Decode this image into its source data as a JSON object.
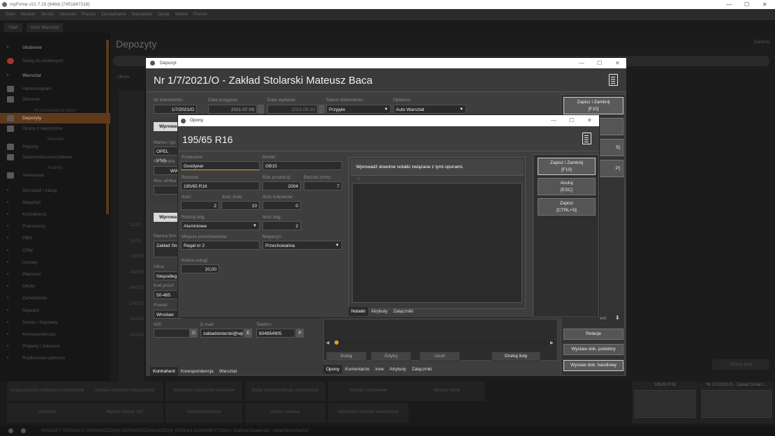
{
  "app": {
    "title": "mpFirma v21.7.15 (64bit) [7451847216]",
    "menu": [
      "Start",
      "Moduły",
      "Skróty",
      "Słowniki",
      "Poczta",
      "Zarządzanie",
      "Narzędzia",
      "Opcje",
      "Widok",
      "Pomoc"
    ],
    "tabs": [
      "Start",
      "Auto Warsztat"
    ]
  },
  "sidebar": {
    "items": [
      {
        "label": "Ulubione",
        "type": "head"
      },
      {
        "label": "Dodaj do ulubionych",
        "type": "item"
      },
      {
        "label": "Warsztat",
        "type": "head"
      },
      {
        "label": "Harmonogram",
        "type": "item"
      },
      {
        "label": "Zlecenia",
        "type": "item"
      },
      {
        "label": "Przechowalnia opon",
        "type": "sub"
      },
      {
        "label": "Depozyty",
        "type": "active"
      },
      {
        "label": "Opony z depozytów",
        "type": "item"
      },
      {
        "label": "Słowniki",
        "type": "sub"
      },
      {
        "label": "Pojazdy",
        "type": "item"
      },
      {
        "label": "Stanowiska warsztatowe",
        "type": "item"
      },
      {
        "label": "Analizy",
        "type": "sub"
      },
      {
        "label": "Serwisanci",
        "type": "item"
      },
      {
        "label": "Sprzedaż i zakup",
        "type": "cat"
      },
      {
        "label": "Magazyn",
        "type": "cat"
      },
      {
        "label": "Kontrahenci",
        "type": "cat"
      },
      {
        "label": "Pracownicy",
        "type": "cat"
      },
      {
        "label": "PBKi",
        "type": "cat"
      },
      {
        "label": "CRM",
        "type": "cat"
      },
      {
        "label": "Umowy",
        "type": "cat"
      },
      {
        "label": "Płatności",
        "type": "cat"
      },
      {
        "label": "Oferty",
        "type": "cat"
      },
      {
        "label": "Zamówienia",
        "type": "cat"
      },
      {
        "label": "Rejestry",
        "type": "cat"
      },
      {
        "label": "Serwis i Naprawy",
        "type": "cat"
      },
      {
        "label": "Korespondencja",
        "type": "cat"
      },
      {
        "label": "Projekty i Zlecenia",
        "type": "cat"
      },
      {
        "label": "Rozliczenia cykliczne",
        "type": "cat"
      }
    ]
  },
  "main": {
    "title": "Depozyty",
    "close_label": "Zamknij",
    "print_list": "Drukuj listę",
    "okres_label": "Okres"
  },
  "bottom_tiles": [
    "Dodaj przycisk szybkiego uruchamiania",
    "Wystaw dokument magazynowy",
    "Wprowadź zgłoszenie serwisowe",
    "Dodaj korespondencję (zewnętrzną)",
    "Wystaw zamówienie",
    "Wystaw ofertę",
    "Sprzedaż",
    "Wystaw fakturę VAT",
    "Dodaj kontrahenta",
    "Utwórz zadanie",
    "Wprowadź zlecenie warsztatowe"
  ],
  "preview_labels": [
    "195/65 R16",
    "Nr 1/7/2021/O - Zakład Stolars..."
  ],
  "status_text": "KINSOFT SPÓŁKA Z OGRANICZONĄ ODPOWIEDZIALNOŚCIĄ SPÓŁKA KOMANDYTOWA \\ Oddział Dealerski - rabat/Warsztat/ltd",
  "depozyt": {
    "window_title": "Depozyt",
    "header": "Nr 1/7/2021/O - Zakład Stolarski Mateusz Baca",
    "nr_label": "Nr dokumentu:",
    "nr_value": "1/7/2021/O",
    "data_przyjecia_label": "Data przyjęcia:",
    "data_przyjecia": "2021-07-09",
    "data_wydania_label": "Data wydania:",
    "data_wydania": "2021-09-10",
    "status_label": "Status dokumentu:",
    "status_value": "Przyjęte",
    "opiekun_label": "Opiekun:",
    "opiekun_value": "Auto Warsztat",
    "nr_dok_partial": "Nr doku",
    "wprowadz_btn": "Wprowa",
    "marka_label": "Marka i typ",
    "marka_value": "OPEL VIVA",
    "nr_rej_label": "Nr rejestra",
    "nr_rej_value": "WW",
    "moc_label": "Moc silnika",
    "wprowadz_btn2": "Wprowa",
    "nazwa_label": "Nazwa firm",
    "nazwa_value": "Zakład Sto",
    "ulica_label": "Ulica:",
    "ulica_value": "Niepodleg",
    "kod_label": "Kod poczt",
    "kod_value": "50-485",
    "powiat_label": "Powiat:",
    "powiat_value": "Wrocław",
    "nip_label": "NIP:",
    "nip_btn": "G",
    "email_label": "E-mail:",
    "email_value": "zakladstolarski@wp",
    "email_btn": "E",
    "tel_label": "Telefon:",
    "tel_value": "604854905",
    "tel_btn": "P",
    "left_tabs": [
      "Kontrahent",
      "Korespondencja",
      "Warsztat"
    ],
    "right_tabs": [
      "Opony",
      "Komentarze",
      "Inne",
      "Atrybuty",
      "Załączniki"
    ],
    "action_btns": [
      "Dodaj",
      "Edytuj",
      "Usuń"
    ],
    "drukuj": "Drukuj listę",
    "side_buttons": {
      "zapisz_zamknij": "Zapisz i Zamknij",
      "zapisz_zamknij_key": "[F10]",
      "relacje": "Relacje",
      "podobny": "Wystaw dok. podobny",
      "handlowy": "Wystaw dok. handlowy",
      "partial_s": "S]",
      "partial_p": "P]",
      "ent": "ent"
    },
    "dates_bg": [
      "1/11/2",
      "1/10/2",
      "1/5/202",
      "4/4/202",
      "3/4/202",
      "2/4/202",
      "1/6/202",
      "1/5/202"
    ]
  },
  "opony": {
    "window_title": "Opony",
    "header": "195/65 R16",
    "producent_label": "Producent:",
    "producent": "Goodyear",
    "model_label": "Model:",
    "model": "GB15",
    "rozmiar_label": "Rozmiar:",
    "rozmiar": "195/65 R16",
    "rok_label": "Rok produkcji:",
    "rok": "2004",
    "bieznik_label": "Bieżnik (mm):",
    "bieznik": "7",
    "ilosc_label": "Ilość:",
    "ilosc": "2",
    "ilosc_srub_label": "Ilość śrub:",
    "ilosc_srub": "10",
    "ilosc_kolpakow_label": "Ilość kołpaków:",
    "ilosc_kolpakow": "0",
    "rodzaj_felg_label": "Rodzaj felg:",
    "rodzaj_felg": "Aluminiowe",
    "ilosc_felg_label": "Ilość felg:",
    "ilosc_felg": "2",
    "miejsce_label": "Miejsce przechowania:",
    "miejsce": "Regał nr 2",
    "magazyn_label": "Magazyn:",
    "magazyn": "Przechowalnia",
    "kwota_label": "Kwota usługi:",
    "kwota": "20,00",
    "notes_hint": "Wprowadź dowolne notatki związane z tymi oponami.",
    "tabs": [
      "Notatki",
      "Atrybuty",
      "Załączniki"
    ],
    "buttons": [
      {
        "l1": "Zapisz i Zamknij",
        "l2": "[F10]"
      },
      {
        "l1": "Anuluj",
        "l2": "[ESC]"
      },
      {
        "l1": "Zapisz",
        "l2": "[CTRL+S]"
      }
    ]
  },
  "icons": {
    "minimize": "—",
    "maximize": "☐",
    "close": "✕"
  }
}
